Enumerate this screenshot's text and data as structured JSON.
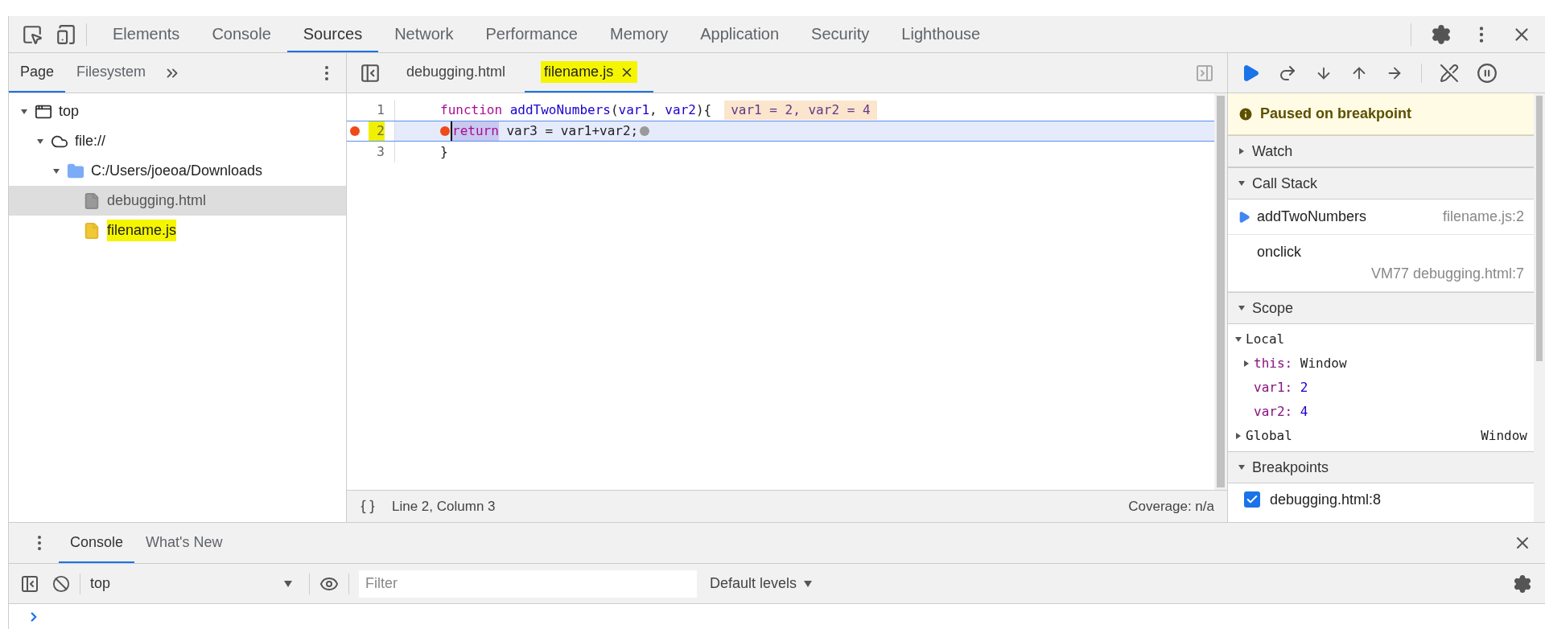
{
  "main_tabs": [
    {
      "label": "Elements",
      "selected": false
    },
    {
      "label": "Console",
      "selected": false
    },
    {
      "label": "Sources",
      "selected": true
    },
    {
      "label": "Network",
      "selected": false
    },
    {
      "label": "Performance",
      "selected": false
    },
    {
      "label": "Memory",
      "selected": false
    },
    {
      "label": "Application",
      "selected": false
    },
    {
      "label": "Security",
      "selected": false
    },
    {
      "label": "Lighthouse",
      "selected": false
    }
  ],
  "navigator": {
    "tabs": [
      {
        "label": "Page",
        "selected": true
      },
      {
        "label": "Filesystem",
        "selected": false
      }
    ],
    "tree": [
      {
        "kind": "frame",
        "label": "top",
        "expanded": true,
        "selected": false,
        "highlighted": false,
        "children": [
          {
            "kind": "domain",
            "label": "file://",
            "expanded": true,
            "selected": false,
            "highlighted": false,
            "children": [
              {
                "kind": "folder",
                "label": "C:/Users/joeoa/Downloads",
                "expanded": true,
                "selected": false,
                "highlighted": false,
                "children": [
                  {
                    "kind": "html",
                    "label": "debugging.html",
                    "selected": true,
                    "highlighted": false
                  },
                  {
                    "kind": "script",
                    "label": "filename.js",
                    "selected": false,
                    "highlighted": true
                  }
                ]
              }
            ]
          }
        ]
      }
    ]
  },
  "editor": {
    "tabs": [
      {
        "label": "debugging.html",
        "selected": false,
        "closable": false,
        "highlighted": false
      },
      {
        "label": "filename.js",
        "selected": true,
        "closable": true,
        "highlighted": true
      }
    ],
    "lines": [
      {
        "number": "1",
        "breakpoint": false,
        "current": false,
        "highlighted": false,
        "tokens": [
          {
            "kind": "keyword",
            "text": "function"
          },
          {
            "kind": "name",
            "text": "addTwoNumbers"
          },
          {
            "kind": "plain",
            "text": "("
          },
          {
            "kind": "param",
            "text": "var1"
          },
          {
            "kind": "plain",
            "text": ", "
          },
          {
            "kind": "param",
            "text": "var2"
          },
          {
            "kind": "plain",
            "text": "){"
          },
          {
            "kind": "inline-values",
            "text": "var1 = 2, var2 = 4"
          }
        ]
      },
      {
        "number": "2",
        "breakpoint": true,
        "current": true,
        "highlighted": true,
        "tokens": [
          {
            "kind": "bp-on"
          },
          {
            "kind": "selection",
            "text": "return"
          },
          {
            "kind": "plain",
            "text": " var3 = var1+var2;"
          },
          {
            "kind": "bp-off"
          }
        ]
      },
      {
        "number": "3",
        "breakpoint": false,
        "current": false,
        "highlighted": false,
        "tokens": [
          {
            "kind": "plain",
            "text": "}"
          }
        ]
      }
    ],
    "status": {
      "position": "Line 2, Column 3",
      "coverage": "Coverage: n/a"
    }
  },
  "debugger": {
    "banner": "Paused on breakpoint",
    "watch": {
      "title": "Watch",
      "expanded": false
    },
    "call_stack": {
      "title": "Call Stack",
      "expanded": true,
      "frames": [
        {
          "function": "addTwoNumbers",
          "location": "filename.js:2",
          "selected": true
        },
        {
          "function": "onclick",
          "location": "VM77 debugging.html:7",
          "selected": false
        }
      ]
    },
    "scope": {
      "title": "Scope",
      "expanded": true,
      "groups": [
        {
          "name": "Local",
          "expanded": true,
          "properties": [
            {
              "name": "this:",
              "value": "Window",
              "kind": "object"
            },
            {
              "name": "var1:",
              "value": "2",
              "kind": "number"
            },
            {
              "name": "var2:",
              "value": "4",
              "kind": "number"
            }
          ]
        },
        {
          "name": "Global",
          "expanded": false,
          "summary": "Window"
        }
      ]
    },
    "breakpoints": {
      "title": "Breakpoints",
      "expanded": true,
      "items": [
        {
          "label": "debugging.html:8",
          "checked": true
        }
      ]
    }
  },
  "drawer": {
    "tabs": [
      {
        "label": "Console",
        "selected": true
      },
      {
        "label": "What's New",
        "selected": false
      }
    ],
    "context": "top",
    "filter_placeholder": "Filter",
    "levels": "Default levels"
  }
}
